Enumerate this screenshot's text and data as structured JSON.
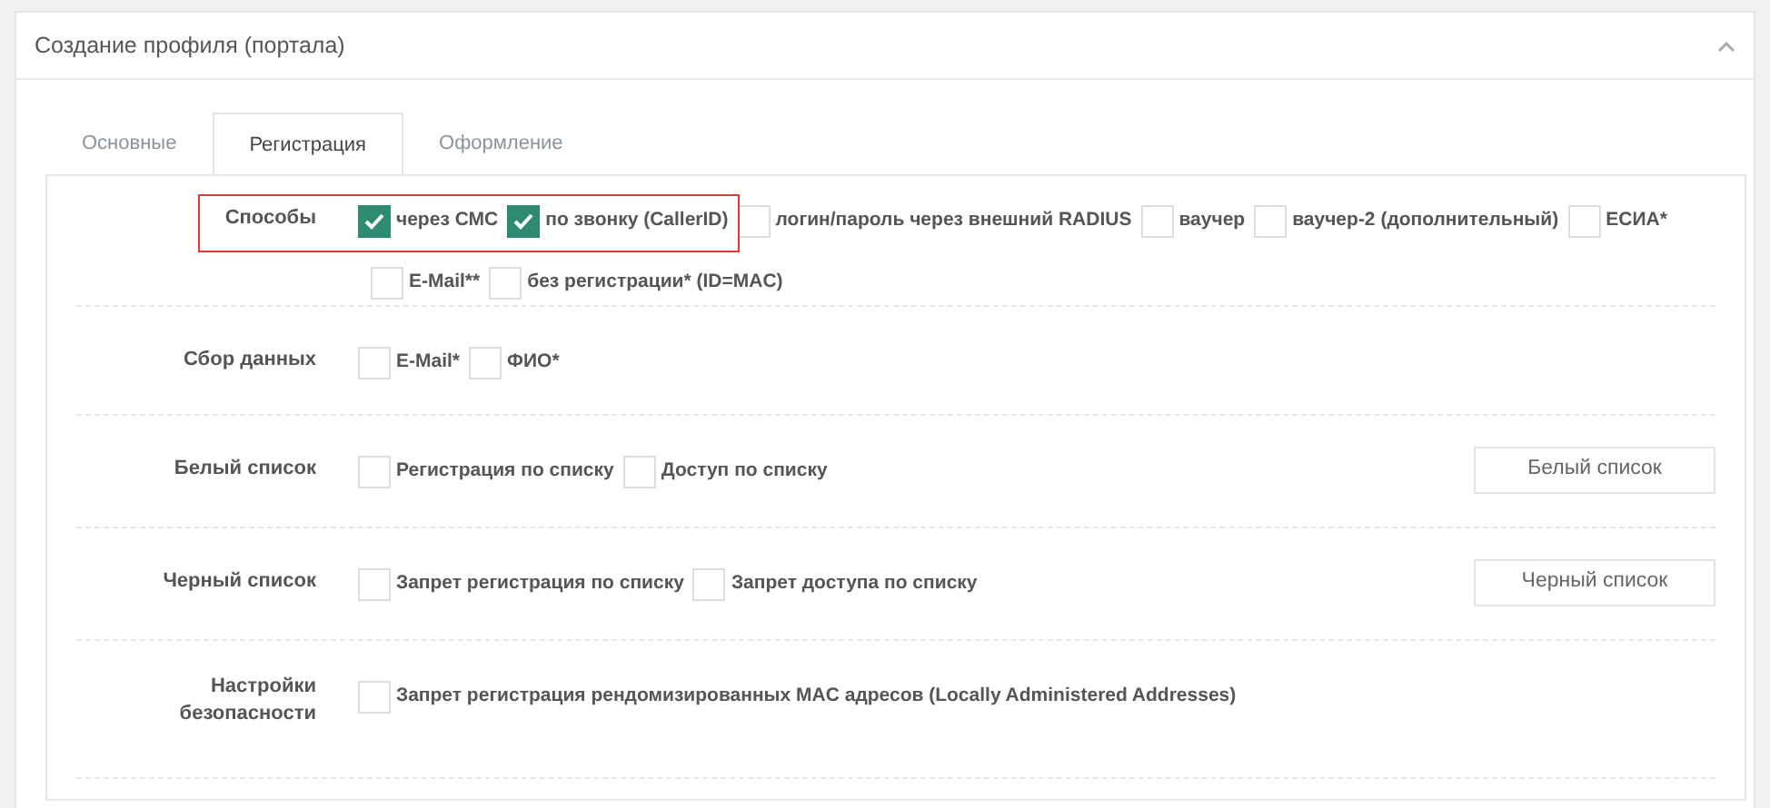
{
  "panel": {
    "title": "Создание профиля (портала)",
    "expanded": true
  },
  "tabs": [
    {
      "label": "Основные",
      "selected": false
    },
    {
      "label": "Регистрация",
      "selected": true
    },
    {
      "label": "Оформление",
      "selected": false
    }
  ],
  "sections": [
    {
      "label": "Способы",
      "options": [
        {
          "label": "через СМС",
          "checked": true,
          "highlighted": true
        },
        {
          "label": "по звонку (CallerID)",
          "checked": true,
          "highlighted": true
        },
        {
          "label": "логин/пароль через внешний RADIUS",
          "checked": false,
          "highlighted": false
        },
        {
          "label": "ваучер",
          "checked": false,
          "highlighted": false
        },
        {
          "label": "ваучер-2 (дополнительный)",
          "checked": false,
          "highlighted": false
        },
        {
          "label": "ЕСИА*",
          "checked": false,
          "highlighted": false
        },
        {
          "label": "E-Mail**",
          "checked": false,
          "highlighted": false
        },
        {
          "label": "без регистрации* (ID=MAC)",
          "checked": false,
          "highlighted": false
        }
      ]
    },
    {
      "label": "Сбор данных",
      "options": [
        {
          "label": "E-Mail*",
          "checked": false
        },
        {
          "label": "ФИО*",
          "checked": false
        }
      ]
    },
    {
      "label": "Белый список",
      "button": "Белый список",
      "options": [
        {
          "label": "Регистрация по списку",
          "checked": false
        },
        {
          "label": "Доступ по списку",
          "checked": false
        }
      ]
    },
    {
      "label": "Черный список",
      "button": "Черный список",
      "options": [
        {
          "label": "Запрет регистрация по списку",
          "checked": false
        },
        {
          "label": "Запрет доступа по списку",
          "checked": false
        }
      ]
    },
    {
      "label": "Настройки безопасности",
      "options": [
        {
          "label": "Запрет регистрация рендомизированных MAC адресов (Locally Administered Addresses)",
          "checked": false
        }
      ]
    }
  ]
}
